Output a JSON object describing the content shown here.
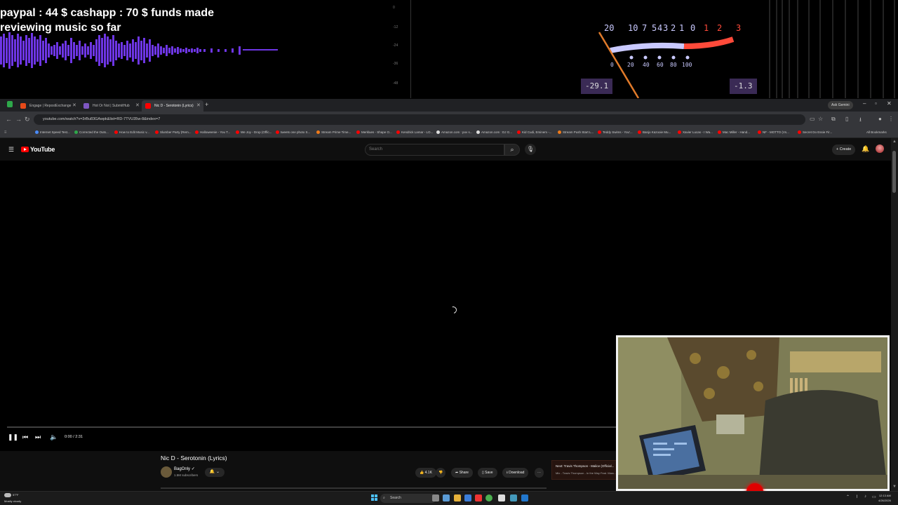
{
  "overlay": {
    "funds_text": "paypal : 44 $  cashapp : 70 $ funds made reviewing music so far",
    "vu_top_ticks": [
      "20",
      "10",
      "7",
      "5",
      "4",
      "3",
      "2",
      "1",
      "0",
      "1",
      "2",
      "3"
    ],
    "vu_bottom_ticks": [
      "0",
      "20",
      "40",
      "60",
      "80",
      "100"
    ],
    "readout_left": "-29.1",
    "readout_right": "-1.3",
    "colors": {
      "waveform": "#7a3cff",
      "vu_normal": "#c9c9ff",
      "vu_red": "#ff4a3a",
      "needle": "#e07a2a"
    }
  },
  "browser": {
    "tabs": [
      {
        "label": "Engage | RepostExchange",
        "color": "#e64a19"
      },
      {
        "label": "Hot Or Not | SubmitHub",
        "color": "#7e57c2"
      },
      {
        "label": "Nic D - Serotonin (Lyrics)",
        "color": "#ff0000"
      }
    ],
    "ask_gemini": "Ask Gemini",
    "url": "youtube.com/watch?v=3rBu83GAwpk&list=RD-7TVU35w-8&index=7",
    "bookmarks": [
      "Internet Speed Test...",
      "Corrected the Outs...",
      "How to Edit Music v...",
      "Slumber Party (Rem...",
      "Halloweenie - You T...",
      "We Joy - Drop (Offic...",
      "tweets one photo S...",
      "Stream Prime Time...",
      "Merklues - Shape O...",
      "Kendrick Lamar - LO...",
      "Amazon.com : pov s...",
      "Amazon.com : DJ G...",
      "Kid Cudi, Eminem -...",
      "Stream Push Start L...",
      "Teddy Swims - You'...",
      "Banjo Kazooie Mu...",
      "Xavier Lucas - I Wa...",
      "Mac Miller - Hand...",
      "NF - MOTTO (Vs...",
      "Secret Do Essie Fir..."
    ],
    "all_bookmarks": "All Bookmarks"
  },
  "youtube": {
    "logo_text": "YouTube",
    "search_placeholder": "Search",
    "create_label": "Create",
    "time": "0:00 / 2:31",
    "video_title": "Nic D - Serotonin (Lyrics)",
    "channel_name": "BagOnly",
    "channel_subs": "1.5M subscribers",
    "likes": "4.1K",
    "share_label": "Share",
    "save_label": "Save",
    "download_label": "Download",
    "up_next_title": "Next: Travis Thompson - Malice (Official...",
    "up_next_sub": "Mix - Travis Thompson - In the Way Feat. Marc..."
  },
  "taskbar": {
    "weather_temp": "57°F",
    "weather_desc": "Mostly cloudy",
    "search_label": "Search",
    "time": "12:13 AM",
    "date": "4/26/2026"
  }
}
